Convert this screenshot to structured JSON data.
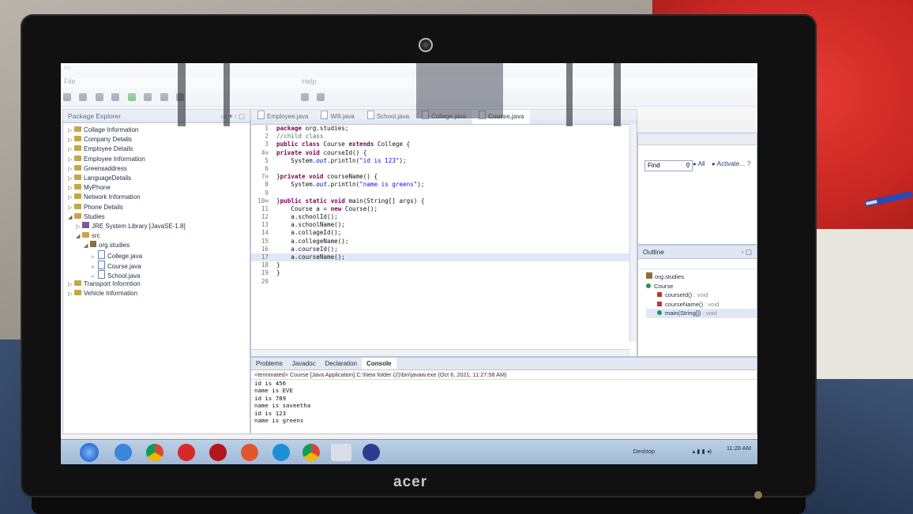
{
  "window": {
    "title": "ec",
    "menu": [
      "File",
      "Help"
    ]
  },
  "package_explorer": {
    "title": "Package Explorer",
    "items": [
      {
        "label": "Collage Information",
        "level": 0,
        "kind": "project"
      },
      {
        "label": "Company Details",
        "level": 0,
        "kind": "project"
      },
      {
        "label": "Employee Details",
        "level": 0,
        "kind": "project"
      },
      {
        "label": "Employee Information",
        "level": 0,
        "kind": "project"
      },
      {
        "label": "Greensaddress",
        "level": 0,
        "kind": "project"
      },
      {
        "label": "LanguageDetails",
        "level": 0,
        "kind": "project"
      },
      {
        "label": "MyPhone",
        "level": 0,
        "kind": "project"
      },
      {
        "label": "Network Information",
        "level": 0,
        "kind": "project"
      },
      {
        "label": "Phone Details",
        "level": 0,
        "kind": "project"
      },
      {
        "label": "Studies",
        "level": 0,
        "kind": "project-open"
      },
      {
        "label": "JRE System Library [JavaSE-1.8]",
        "level": 1,
        "kind": "jar"
      },
      {
        "label": "src",
        "level": 1,
        "kind": "folder-open"
      },
      {
        "label": "org.studies",
        "level": 2,
        "kind": "package"
      },
      {
        "label": "College.java",
        "level": 3,
        "kind": "file"
      },
      {
        "label": "Course.java",
        "level": 3,
        "kind": "file"
      },
      {
        "label": "School.java",
        "level": 3,
        "kind": "file"
      },
      {
        "label": "Transport Informtion",
        "level": 0,
        "kind": "project"
      },
      {
        "label": "Vehicle Information",
        "level": 0,
        "kind": "project"
      }
    ]
  },
  "editor": {
    "tabs": [
      "Employee.java",
      "Wifi.java",
      "School.java",
      "College.java",
      "Course.java"
    ],
    "active_tab": "Course.java",
    "lines": [
      {
        "n": "1",
        "html": "<span class=\"kw\">package</span> org.studies;"
      },
      {
        "n": "2",
        "html": "<span class=\"cm\">//child class</span>"
      },
      {
        "n": "3",
        "html": "<span class=\"kw\">public class</span> Course <span class=\"kw\">extends</span> College {"
      },
      {
        "n": "4⊖",
        "html": "<span class=\"kw\">private void</span> courseId() {"
      },
      {
        "n": "5",
        "html": "    System.<span class=\"it\">out</span>.println(<span class=\"str\">\"id is 123\"</span>);"
      },
      {
        "n": "6",
        "html": ""
      },
      {
        "n": "7⊖",
        "html": "}<span class=\"kw\">private void</span> courseName() {"
      },
      {
        "n": "8",
        "html": "    System.<span class=\"it\">out</span>.println(<span class=\"str\">\"name is greens\"</span>);"
      },
      {
        "n": "9",
        "html": ""
      },
      {
        "n": "10⊖",
        "html": "}<span class=\"kw\">public static void</span> main(String[] args) {"
      },
      {
        "n": "11",
        "html": "    Course a = <span class=\"kw\">new</span> Course();"
      },
      {
        "n": "12",
        "html": "    a.schoolId();"
      },
      {
        "n": "13",
        "html": "    a.schoolName();"
      },
      {
        "n": "14",
        "html": "    a.collageId();"
      },
      {
        "n": "15",
        "html": "    a.collegeName();"
      },
      {
        "n": "16",
        "html": "    a.courseId();"
      },
      {
        "n": "17",
        "html": "    a.courseName();"
      },
      {
        "n": "18",
        "html": "}"
      },
      {
        "n": "19",
        "html": "}"
      },
      {
        "n": "20",
        "html": ""
      }
    ],
    "highlighted_line": "17"
  },
  "right_top": {
    "find_label": "Find",
    "all_label": "All",
    "activate_label": "Activate..."
  },
  "outline": {
    "title": "Outline",
    "items": [
      {
        "label": "org.studies",
        "suffix": "",
        "kind": "package",
        "level": 0
      },
      {
        "label": "Course",
        "suffix": "",
        "kind": "class",
        "level": 0
      },
      {
        "label": "courseId()",
        "suffix": " : void",
        "kind": "private",
        "level": 1
      },
      {
        "label": "courseName()",
        "suffix": " : void",
        "kind": "private",
        "level": 1
      },
      {
        "label": "main(String[])",
        "suffix": " : void",
        "kind": "public",
        "level": 1
      }
    ]
  },
  "bottom_panel": {
    "tabs": [
      "Problems",
      "Javadoc",
      "Declaration",
      "Console"
    ],
    "active_tab": "Console",
    "terminated": "<terminated> Course [Java Application] C:\\New folder (2)\\bin\\javaw.exe (Oct 6, 2021, 11:27:58 AM)",
    "output": [
      "id is 456",
      "name is EVE",
      "id is 789",
      "name is saveetha",
      "id is 123",
      "name is greens"
    ]
  },
  "taskbar": {
    "desktop_label": "Desktop",
    "time": "11:28 AM"
  },
  "laptop": {
    "brand": "acer"
  },
  "colors": {
    "eclipse_tab": "#dfe7f2",
    "keyword": "#7f0055",
    "string": "#2a00ff",
    "comment": "#3f7f5f"
  }
}
